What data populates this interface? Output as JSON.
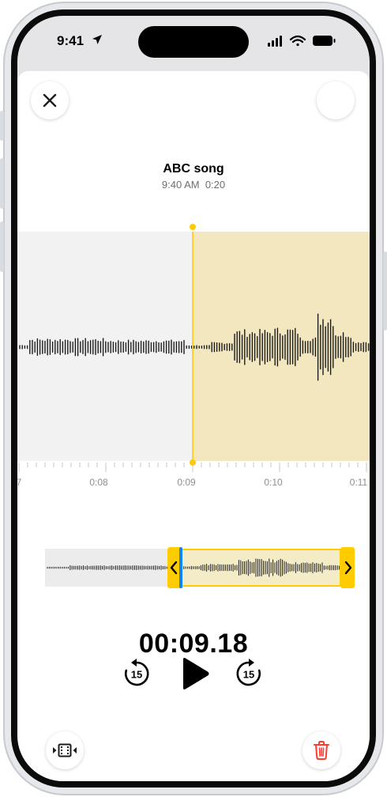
{
  "status_bar": {
    "time": "9:41"
  },
  "recording": {
    "title": "ABC song",
    "date": "9:40 AM",
    "duration": "0:20"
  },
  "timeline": {
    "tick_labels": [
      "7",
      "0:08",
      "0:09",
      "0:10",
      "0:11"
    ]
  },
  "playback": {
    "elapsed": "00:09.18",
    "skip_back_seconds": "15",
    "skip_forward_seconds": "15"
  },
  "colors": {
    "accent": "#ffcc00",
    "selection_fill": "#f2e7bf",
    "playhead": "#0a84ff",
    "delete": "#ff3b30"
  },
  "icons": {
    "close": "close-icon",
    "skip_back": "skip-back-15-icon",
    "play": "play-icon",
    "skip_forward": "skip-forward-15-icon",
    "trim": "trim-icon",
    "delete": "trash-icon"
  }
}
